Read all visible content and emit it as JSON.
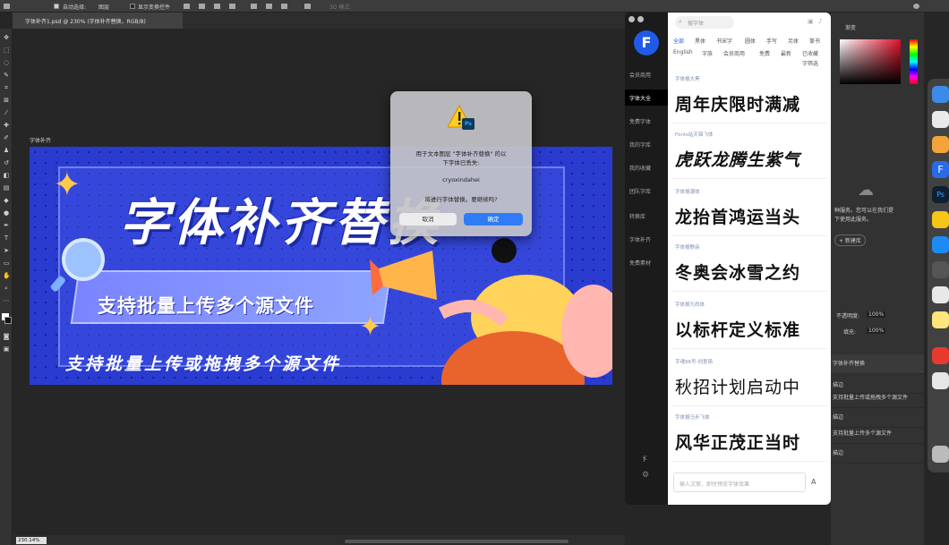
{
  "options_bar": {
    "auto_select_label": "自动选择:",
    "auto_select_value": "图层",
    "show_transform_label": "显示变换控件",
    "mode_3d_label": "3D 模式:"
  },
  "document": {
    "tab_title": "字体补齐1.psd @ 230% (字体补齐替换，RGB/8)",
    "artboard_label": "字体补齐",
    "zoom": "230.14%"
  },
  "banner": {
    "title": "字体补齐替换",
    "subtitle": "支持批量上传多个源文件",
    "tagline": "支持批量上传或拖拽多个源文件"
  },
  "dialog": {
    "message_line1": "用于文本图层 \"字体补齐替换\" 的以",
    "message_line2": "下字体已丢失:",
    "missing_font": "cryoxindahei",
    "question": "将进行字体替换。要继续吗?",
    "cancel_label": "取消",
    "ok_label": "确定",
    "ps_badge": "Ps"
  },
  "font_plugin": {
    "logo": "F",
    "search_placeholder": "搜字体",
    "nav": [
      {
        "label": "会员商用"
      },
      {
        "label": "字体大全"
      },
      {
        "label": "免费字体"
      },
      {
        "label": "我的字库"
      },
      {
        "label": "我的收藏"
      },
      {
        "label": "团队字库"
      },
      {
        "label": "转换库"
      },
      {
        "label": "字体补齐"
      },
      {
        "label": "免费素材"
      }
    ],
    "categories_row1": [
      "全部",
      "黑体",
      "书宋字",
      "圆体",
      "手写",
      "另体",
      "篆书"
    ],
    "categories_row2": [
      "English",
      "字族",
      "会员商用",
      "免费",
      "最新",
      "已收藏"
    ],
    "filter_label": "字筛选",
    "fonts": [
      {
        "meta": "字体报大黑",
        "sample": "周年庆限时满减"
      },
      {
        "meta": "Fonts站天锦飞体",
        "sample": "虎跃龙腾生紫气"
      },
      {
        "meta": "字体报潮体",
        "sample": "龙抬首鸿运当头"
      },
      {
        "meta": "字体报野戾",
        "sample": "冬奥会冰雪之约"
      },
      {
        "meta": "字体报为尚体",
        "sample": "以标杆定义标准"
      },
      {
        "meta": "字魂96号-创意简",
        "sample": "秋招计划启动中"
      },
      {
        "meta": "字体报马步飞体",
        "sample": "风华正茂正当时"
      }
    ],
    "preview_placeholder": "输入文案，即时预览字体效果",
    "preview_button": "A"
  },
  "right_panel": {
    "tab_swatches": "渐变",
    "cloud_hint_line1": "种服务。您可以在我们提",
    "cloud_hint_line2": "下使用此服务。",
    "create_lib": "+ 新建库",
    "opacity_label": "不透明度:",
    "opacity_value": "100%",
    "fill_label": "填充:",
    "fill_value": "100%",
    "layers": [
      {
        "name": "字体补齐替换"
      },
      {
        "name": "描边"
      },
      {
        "name": "支持批量上传或拖拽多个源文件"
      },
      {
        "name": "描边"
      },
      {
        "name": "支持批量上传多个源文件"
      },
      {
        "name": "描边"
      }
    ]
  },
  "colors": {
    "banner_bg": "#2a3bd0",
    "accent_blue": "#2f7cf6",
    "plugin_logo": "#1f5be8",
    "star_yellow": "#ffc94a"
  }
}
